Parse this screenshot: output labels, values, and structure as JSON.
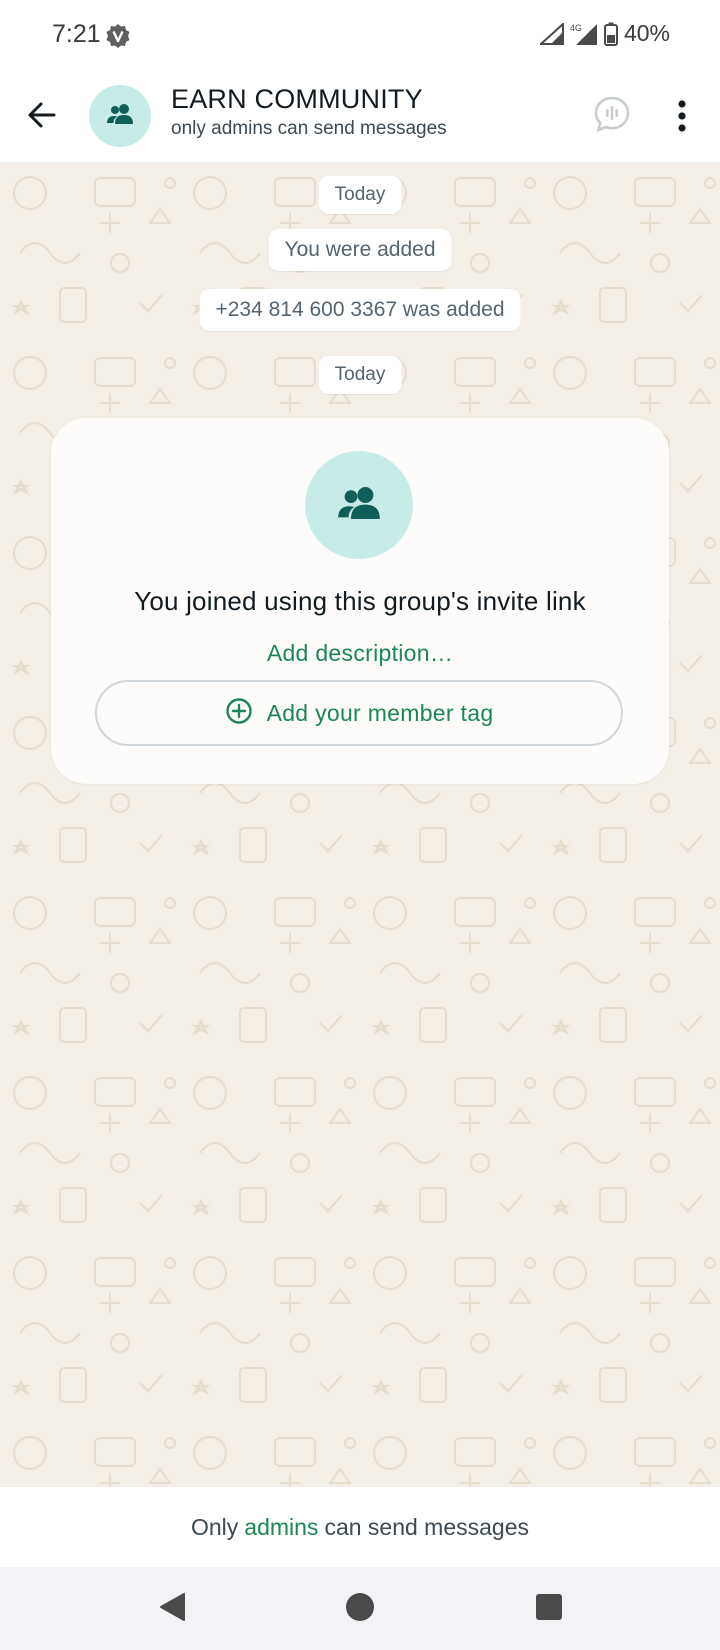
{
  "status_bar": {
    "time": "7:21",
    "network": "4G",
    "battery": "40%",
    "icons": [
      "v-badge-icon",
      "signal-icon",
      "signal-4g-icon",
      "battery-icon"
    ]
  },
  "header": {
    "title": "EARN COMMUNITY",
    "subtitle": "only admins can send messages",
    "icons": [
      "back-arrow-icon",
      "group-avatar-icon",
      "voice-chat-icon",
      "more-vert-icon"
    ]
  },
  "chat": {
    "date_chip_1": "Today",
    "system_1": "You were added",
    "system_2": "+234 814 600 3367 was added",
    "date_chip_2": "Today",
    "info_card": {
      "heading": "You joined using this group's invite link",
      "add_description": "Add description…",
      "member_tag_button": "Add your member tag",
      "icons": [
        "group-icon",
        "add-circle-icon"
      ]
    }
  },
  "footer": {
    "notice_prefix": "Only",
    "notice_link": "admins",
    "notice_suffix": "can send messages"
  },
  "navigation": {
    "icons": [
      "nav-back-icon",
      "nav-home-icon",
      "nav-recents-icon"
    ]
  },
  "colors": {
    "accent_green": "#1b8755",
    "avatar_bg": "#c7ece8",
    "avatar_icon": "#0f5f58",
    "wallpaper_bg": "#f3eee6"
  }
}
